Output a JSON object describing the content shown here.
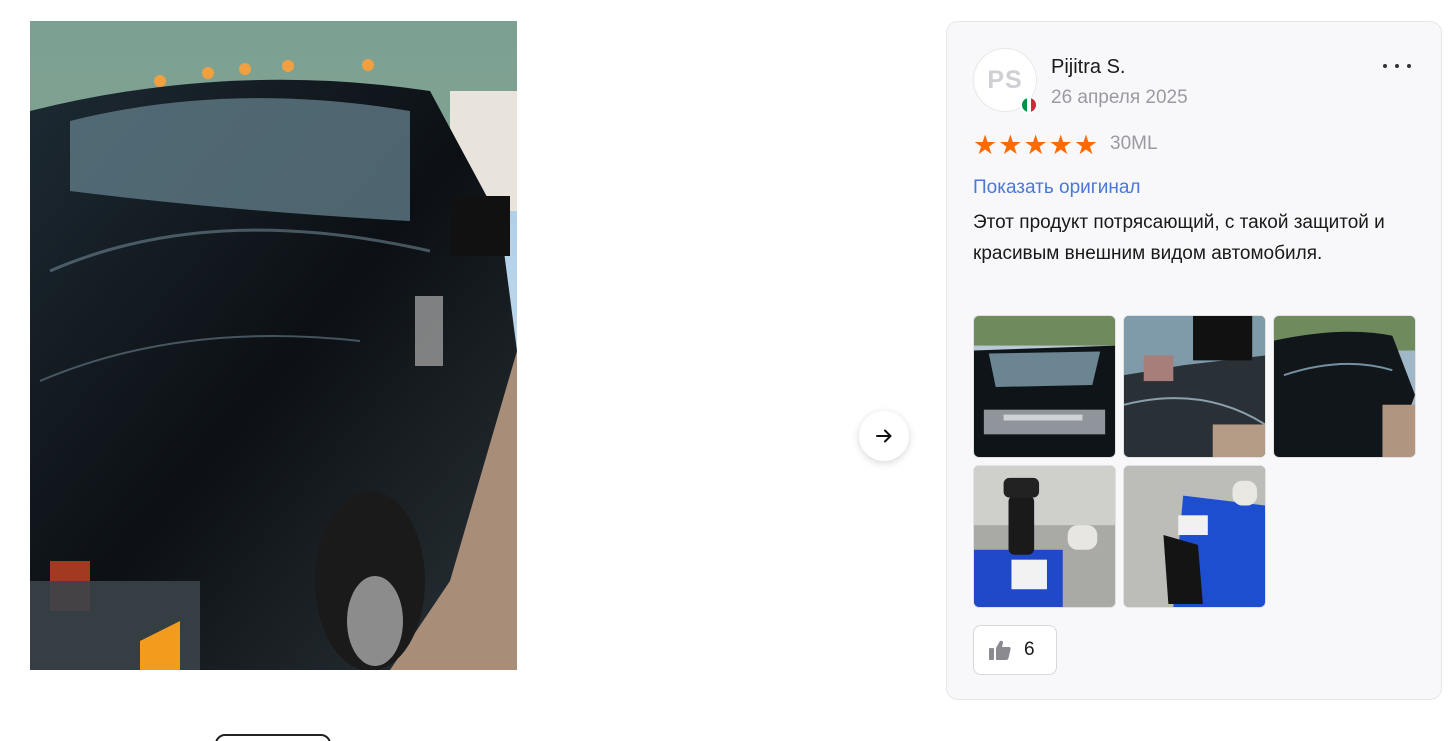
{
  "review": {
    "author_initials": "PS",
    "author_name": "Pijitra S.",
    "date": "26 апреля 2025",
    "rating": 5,
    "stars": [
      "★",
      "★",
      "★",
      "★",
      "★"
    ],
    "variant": "30ML",
    "show_original_label": "Показать оригинал",
    "text": "Этот продукт потрясающий, с такой защитой и красивым внешним видом автомобиля.",
    "likes": "6"
  },
  "icons": {
    "flag": "italy-flag-icon",
    "more": "more-dots-icon",
    "next": "arrow-right-icon",
    "like": "thumbs-up-icon",
    "star": "star-icon"
  },
  "colors": {
    "star": "#ff6a00",
    "link": "#4a78d4",
    "muted": "#9a9aa2",
    "flag": [
      "#009246",
      "#ffffff",
      "#ce2b37"
    ]
  }
}
